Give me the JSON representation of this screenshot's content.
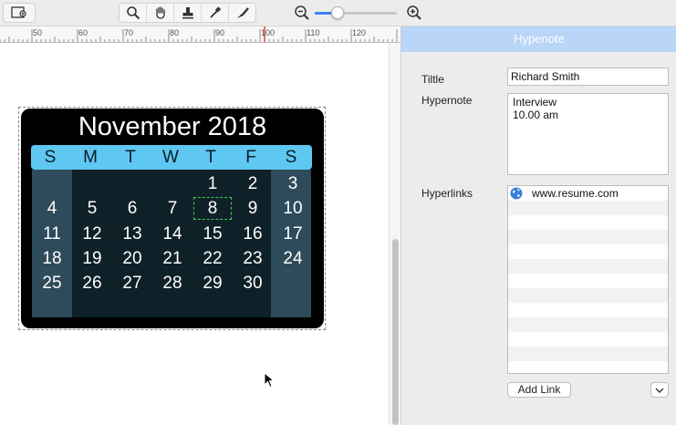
{
  "toolbar": {
    "frame_tool_icon": "frame-icon",
    "tools": [
      "zoom-icon",
      "hand-icon",
      "stamp-icon",
      "eyedropper-icon",
      "brush-icon"
    ],
    "zoom_out_icon": "zoom-out-icon",
    "zoom_in_icon": "zoom-in-icon",
    "zoom_level": 0.28
  },
  "ruler": {
    "labels": [
      "50",
      "60",
      "70",
      "80",
      "90",
      "100",
      "110",
      "120"
    ]
  },
  "calendar": {
    "title": "November 2018",
    "weekdays": [
      "S",
      "M",
      "T",
      "W",
      "T",
      "F",
      "S"
    ],
    "weeks": [
      [
        "",
        "",
        "",
        "",
        "1",
        "2",
        "3"
      ],
      [
        "4",
        "5",
        "6",
        "7",
        "8",
        "9",
        "10"
      ],
      [
        "11",
        "12",
        "13",
        "14",
        "15",
        "16",
        "17"
      ],
      [
        "18",
        "19",
        "20",
        "21",
        "22",
        "23",
        "24"
      ],
      [
        "25",
        "26",
        "27",
        "28",
        "29",
        "30",
        ""
      ]
    ],
    "highlighted_day": "8",
    "colors": {
      "background": "#000000",
      "header": "#5ec8f2",
      "body": "#0f2128",
      "weekend": "#2d4b5a",
      "highlight": "#3ccf5a"
    }
  },
  "panel": {
    "header": "Hypenote",
    "title_label": "Tiltle",
    "title_value": "Richard Smith",
    "note_label": "Hypernote",
    "note_lines": [
      "Interview",
      "10.00 am"
    ],
    "links_label": "Hyperlinks",
    "links": [
      "www.resume.com"
    ],
    "add_link_label": "Add Link",
    "header_color": "#b9d5f7"
  }
}
